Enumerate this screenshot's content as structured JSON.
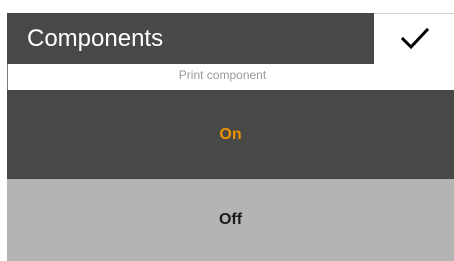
{
  "header": {
    "title": "Components",
    "confirm_icon": "checkmark-icon"
  },
  "subtitle": "Print component",
  "options": [
    {
      "label": "On",
      "selected": true
    },
    {
      "label": "Off",
      "selected": false
    }
  ],
  "colors": {
    "header_bg": "#484846",
    "selected_bg": "#484846",
    "selected_text": "#ee9300",
    "unselected_bg": "#b4b5b3",
    "unselected_text": "#1a1a1a"
  }
}
